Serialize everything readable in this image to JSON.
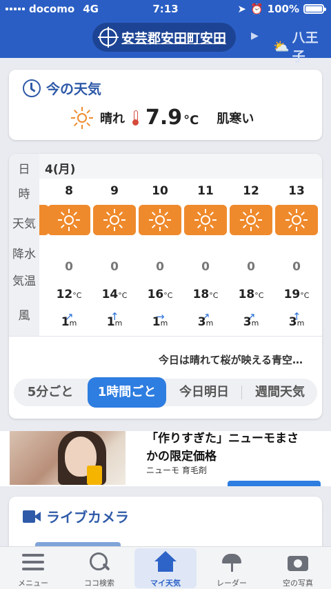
{
  "status": {
    "carrier": "docomo",
    "network": "4G",
    "time": "7:13",
    "battery": "100%"
  },
  "header": {
    "location": "安芸郡安田町安田",
    "next_location": "八王子"
  },
  "current": {
    "title": "今の天気",
    "condition": "晴れ",
    "temp": "7.9",
    "unit": "°C",
    "feel": "肌寒い"
  },
  "forecast": {
    "labels": {
      "day": "日",
      "hour": "時",
      "weather": "天気",
      "rain": "降水",
      "temp": "気温",
      "wind": "風"
    },
    "date": "4(月)",
    "hours": [
      {
        "hour": "8",
        "rain": "0",
        "temp": "12",
        "wind": "1",
        "dir": "SW"
      },
      {
        "hour": "9",
        "rain": "0",
        "temp": "14",
        "wind": "1",
        "dir": "S"
      },
      {
        "hour": "10",
        "rain": "0",
        "temp": "16",
        "wind": "1",
        "dir": "W"
      },
      {
        "hour": "11",
        "rain": "0",
        "temp": "18",
        "wind": "3",
        "dir": "SW"
      },
      {
        "hour": "12",
        "rain": "0",
        "temp": "18",
        "wind": "3",
        "dir": "SW"
      },
      {
        "hour": "13",
        "rain": "0",
        "temp": "19",
        "wind": "3",
        "dir": "S"
      }
    ],
    "temp_unit": "°C",
    "wind_unit": "m",
    "comment": "今日は晴れて桜が映える青空…",
    "tabs": [
      "5分ごと",
      "1時間ごと",
      "今日明日",
      "週間天気"
    ],
    "active_tab": "1時間ごと"
  },
  "ad": {
    "headline_1": "「作りすぎた」ニューモまさ",
    "headline_2": "かの限定価格",
    "source": "ニューモ 育毛剤"
  },
  "live_camera": {
    "title": "ライブカメラ"
  },
  "tabbar": [
    {
      "label": "メニュー",
      "icon": "menu-icon"
    },
    {
      "label": "ココ検索",
      "icon": "search-icon"
    },
    {
      "label": "マイ天気",
      "icon": "home-icon"
    },
    {
      "label": "レーダー",
      "icon": "radar-icon"
    },
    {
      "label": "空の写真",
      "icon": "camera-icon"
    }
  ],
  "colors": {
    "header": "#2a5ec4",
    "sunny_tile": "#ef8a2c",
    "accent": "#2e7de0"
  }
}
